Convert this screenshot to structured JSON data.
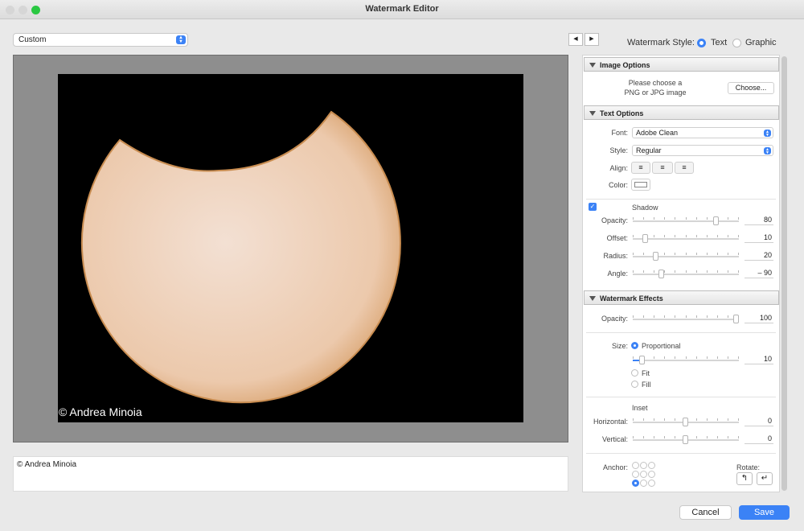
{
  "window": {
    "title": "Watermark Editor"
  },
  "preset": {
    "value": "Custom"
  },
  "preview": {
    "watermark_text": "© Andrea Minoia"
  },
  "text_box": {
    "value": "© Andrea Minoia"
  },
  "watermark_style": {
    "label": "Watermark Style:",
    "options": [
      "Text",
      "Graphic"
    ],
    "selected": "Text"
  },
  "image_options": {
    "title": "Image Options",
    "hint_line1": "Please choose a",
    "hint_line2": "PNG or JPG image",
    "choose_label": "Choose..."
  },
  "text_options": {
    "title": "Text Options",
    "font_label": "Font:",
    "font_value": "Adobe Clean",
    "style_label": "Style:",
    "style_value": "Regular",
    "align_label": "Align:",
    "color_label": "Color:",
    "shadow_label": "Shadow",
    "shadow_checked": true,
    "opacity_label": "Opacity:",
    "opacity_value": "80",
    "offset_label": "Offset:",
    "offset_value": "10",
    "radius_label": "Radius:",
    "radius_value": "20",
    "angle_label": "Angle:",
    "angle_value": "– 90"
  },
  "watermark_effects": {
    "title": "Watermark Effects",
    "opacity_label": "Opacity:",
    "opacity_value": "100",
    "size_label": "Size:",
    "size_options": [
      "Proportional",
      "Fit",
      "Fill"
    ],
    "size_selected": "Proportional",
    "size_value": "10",
    "inset_label": "Inset",
    "horizontal_label": "Horizontal:",
    "horizontal_value": "0",
    "vertical_label": "Vertical:",
    "vertical_value": "0",
    "anchor_label": "Anchor:",
    "anchor_selected": "bottom-left",
    "rotate_label": "Rotate:"
  },
  "buttons": {
    "cancel": "Cancel",
    "save": "Save"
  },
  "colors": {
    "accent": "#3b82f6",
    "sun": "#f2d9c4",
    "close": "#d6d6d6",
    "zoom": "#2ac842"
  }
}
